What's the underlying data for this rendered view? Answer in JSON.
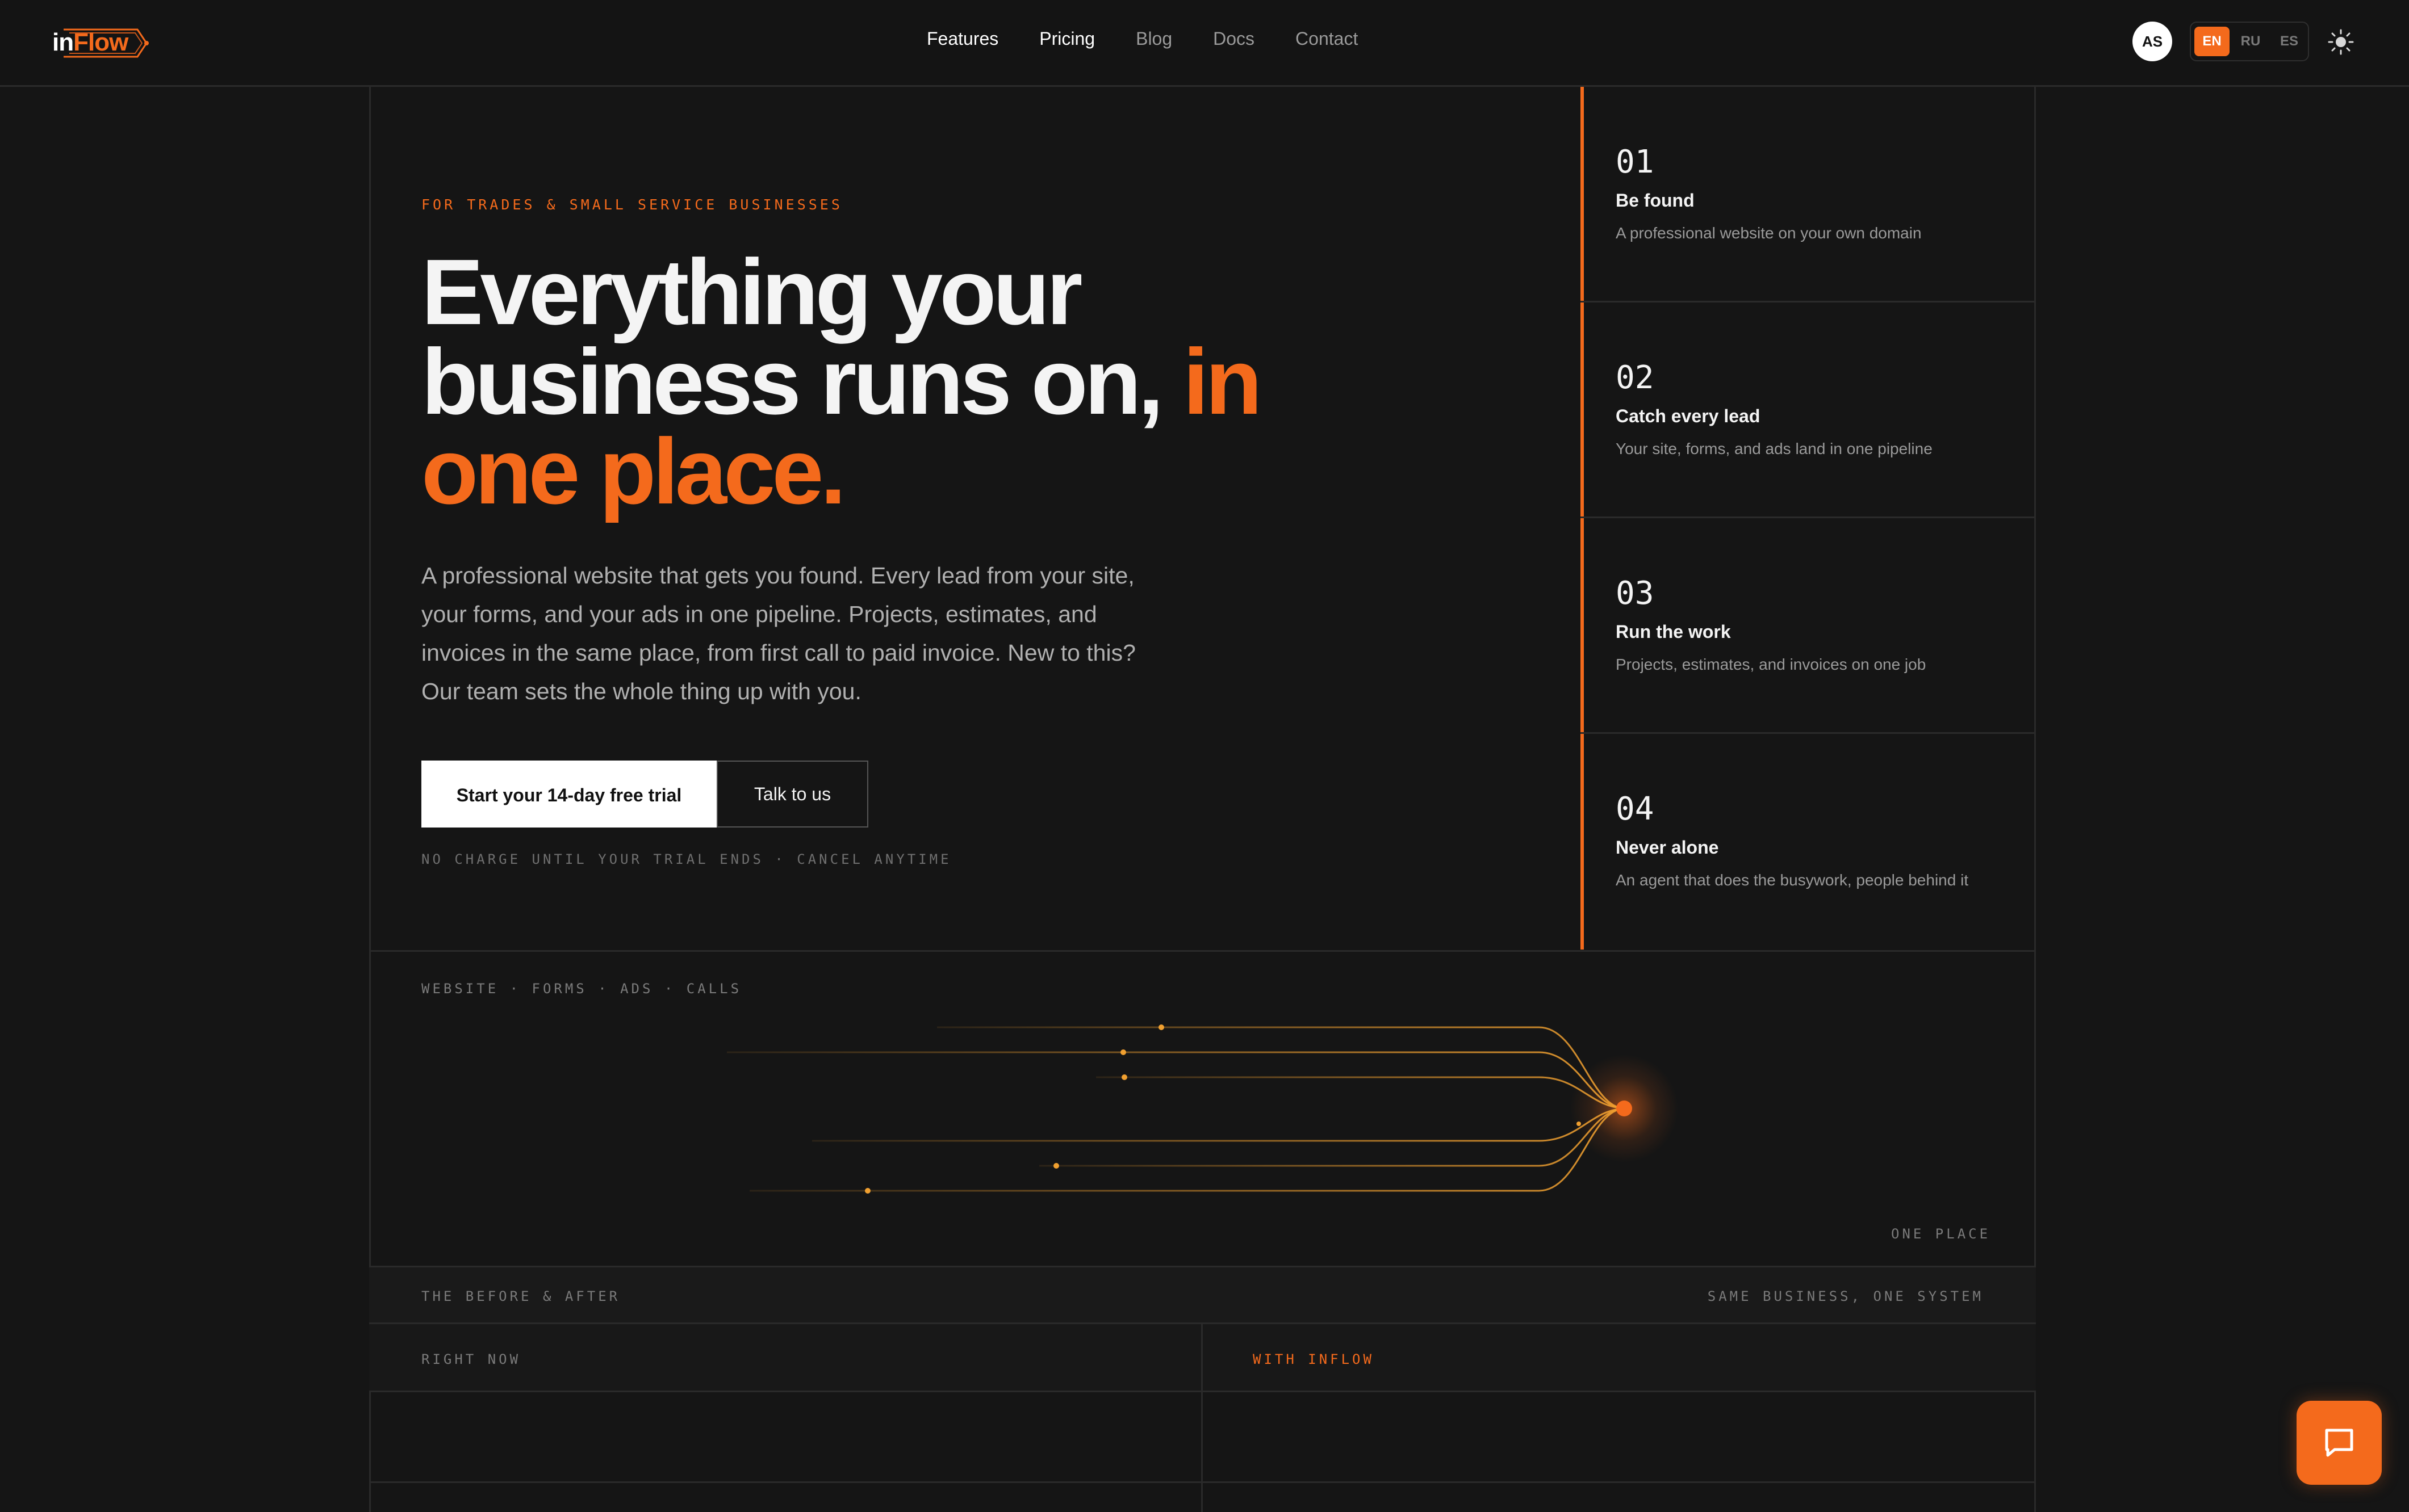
{
  "nav": {
    "logo_part1": "in",
    "logo_part2": "Flow",
    "links": [
      "Features",
      "Pricing",
      "Blog",
      "Docs",
      "Contact"
    ],
    "avatar": "AS",
    "languages": [
      "EN",
      "RU",
      "ES"
    ],
    "active_language": "EN",
    "theme_icon": "sun-icon"
  },
  "hero": {
    "eyebrow": "FOR TRADES & SMALL SERVICE BUSINESSES",
    "headline_part1": "Everything your business runs on, ",
    "headline_part2": "in one place.",
    "lead": "A professional website that gets you found. Every lead from your site, your forms, and your ads in one pipeline. Projects, estimates, and invoices in the same place, from first call to paid invoice. New to this? Our team sets the whole thing up with you.",
    "primary_cta": "Start your 14-day free trial",
    "secondary_cta": "Talk to us",
    "note": "NO CHARGE UNTIL YOUR TRIAL ENDS · CANCEL ANYTIME"
  },
  "features": [
    {
      "num": "01",
      "title": "Be found",
      "desc": "A professional website on your own domain"
    },
    {
      "num": "02",
      "title": "Catch every lead",
      "desc": "Your site, forms, and ads land in one pipeline"
    },
    {
      "num": "03",
      "title": "Run the work",
      "desc": "Projects, estimates, and invoices on one job"
    },
    {
      "num": "04",
      "title": "Never alone",
      "desc": "An agent that does the busywork, people behind it"
    }
  ],
  "flow": {
    "label": "WEBSITE · FORMS · ADS · CALLS",
    "end_label": "ONE PLACE"
  },
  "before_after": {
    "title": "THE BEFORE & AFTER",
    "subtitle": "SAME BUSINESS, ONE SYSTEM",
    "col_before": "RIGHT NOW",
    "col_after": "WITH INFLOW"
  },
  "colors": {
    "accent": "#f46a1c",
    "background": "#151515"
  },
  "chat_icon": "chat-bubble-icon"
}
